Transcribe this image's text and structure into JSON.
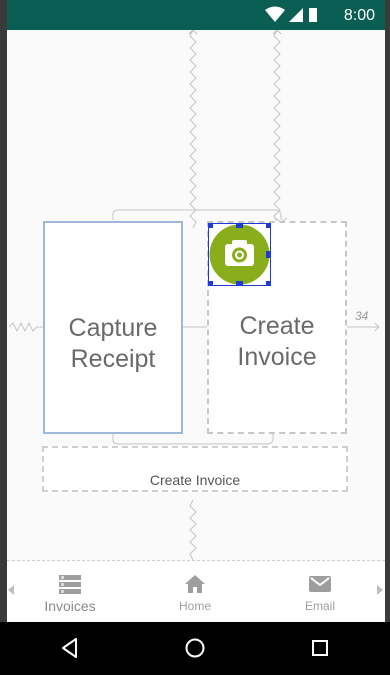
{
  "status": {
    "time": "8:00",
    "icons": [
      "wifi-icon",
      "signal-icon",
      "battery-icon"
    ]
  },
  "cards": {
    "capture_receipt": "Capture\nReceipt",
    "create_invoice": "Create\nInvoice"
  },
  "constraint_margin": "34",
  "wide_button": {
    "label": "Create Invoice"
  },
  "fab": {
    "icon": "camera-icon",
    "color": "#8aad1c"
  },
  "bottom_nav": {
    "items": [
      {
        "label": "Invoices",
        "icon": "list-icon"
      },
      {
        "label": "Home",
        "icon": "home-icon"
      },
      {
        "label": "Email",
        "icon": "email-icon"
      }
    ]
  },
  "system_nav": {
    "buttons": [
      "back-icon",
      "home-circle-icon",
      "recents-icon"
    ]
  },
  "colors": {
    "status_bar": "#0b5e54",
    "accent_green": "#8aad1c",
    "selection_blue": "#1f3bd6"
  }
}
